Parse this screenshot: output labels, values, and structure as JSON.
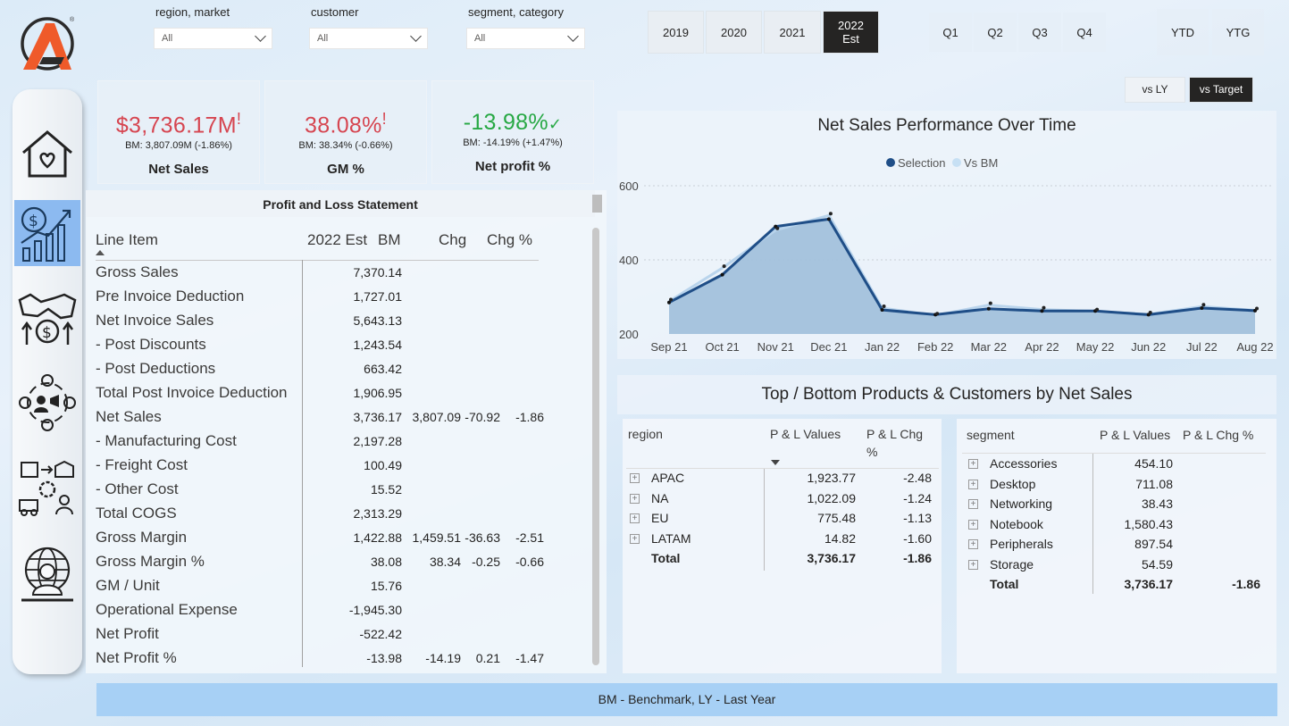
{
  "slicers": [
    {
      "label": "region, market",
      "value": "All"
    },
    {
      "label": "customer",
      "value": "All"
    },
    {
      "label": "segment, category",
      "value": "All"
    }
  ],
  "years": [
    "2019",
    "2020",
    "2021"
  ],
  "year_active_line1": "2022",
  "year_active_line2": "Est",
  "quarters": [
    "Q1",
    "Q2",
    "Q3",
    "Q4"
  ],
  "period": [
    "YTD",
    "YTG"
  ],
  "compare": {
    "vs_ly": "vs LY",
    "vs_target": "vs Target"
  },
  "kpis": [
    {
      "value": "$3,736.17M",
      "flag": "!",
      "sub": "BM: 3,807.09M (-1.86%)",
      "title": "Net Sales",
      "color": "#d64550"
    },
    {
      "value": "38.08%",
      "flag": "!",
      "sub": "BM: 38.34% (-0.66%)",
      "title": "GM %",
      "color": "#d64550"
    },
    {
      "value": "-13.98%",
      "flag": "✓",
      "sub": "BM: -14.19% (+1.47%)",
      "title": "Net profit %",
      "color": "#27a844"
    }
  ],
  "pl": {
    "title": "Profit and Loss Statement",
    "headers": {
      "item": "Line Item",
      "y": "2022 Est",
      "bm": "BM",
      "chg": "Chg",
      "chgp": "Chg %"
    },
    "rows": [
      {
        "item": "Gross Sales",
        "y": "7,370.14",
        "bm": "",
        "chg": "",
        "chgp": ""
      },
      {
        "item": "Pre Invoice Deduction",
        "y": "1,727.01",
        "bm": "",
        "chg": "",
        "chgp": ""
      },
      {
        "item": "Net Invoice Sales",
        "y": "5,643.13",
        "bm": "",
        "chg": "",
        "chgp": ""
      },
      {
        "item": "- Post Discounts",
        "y": "1,243.54",
        "bm": "",
        "chg": "",
        "chgp": ""
      },
      {
        "item": "- Post Deductions",
        "y": "663.42",
        "bm": "",
        "chg": "",
        "chgp": ""
      },
      {
        "item": "Total Post Invoice Deduction",
        "y": "1,906.95",
        "bm": "",
        "chg": "",
        "chgp": ""
      },
      {
        "item": "Net Sales",
        "y": "3,736.17",
        "bm": "3,807.09",
        "chg": "-70.92",
        "chgp": "-1.86"
      },
      {
        "item": "- Manufacturing Cost",
        "y": "2,197.28",
        "bm": "",
        "chg": "",
        "chgp": ""
      },
      {
        "item": "- Freight Cost",
        "y": "100.49",
        "bm": "",
        "chg": "",
        "chgp": ""
      },
      {
        "item": "- Other Cost",
        "y": "15.52",
        "bm": "",
        "chg": "",
        "chgp": ""
      },
      {
        "item": "Total COGS",
        "y": "2,313.29",
        "bm": "",
        "chg": "",
        "chgp": ""
      },
      {
        "item": "Gross Margin",
        "y": "1,422.88",
        "bm": "1,459.51",
        "chg": "-36.63",
        "chgp": "-2.51"
      },
      {
        "item": "Gross Margin %",
        "y": "38.08",
        "bm": "38.34",
        "chg": "-0.25",
        "chgp": "-0.66"
      },
      {
        "item": "GM / Unit",
        "y": "15.76",
        "bm": "",
        "chg": "",
        "chgp": ""
      },
      {
        "item": "Operational Expense",
        "y": "-1,945.30",
        "bm": "",
        "chg": "",
        "chgp": ""
      },
      {
        "item": "Net Profit",
        "y": "-522.42",
        "bm": "",
        "chg": "",
        "chgp": ""
      },
      {
        "item": "Net Profit %",
        "y": "-13.98",
        "bm": "-14.19",
        "chg": "0.21",
        "chgp": "-1.47"
      }
    ]
  },
  "chart_data": {
    "type": "area",
    "title": "Net Sales Performance Over Time",
    "categories": [
      "Sep 21",
      "Oct 21",
      "Nov 21",
      "Dec 21",
      "Jan 22",
      "Feb 22",
      "Mar 22",
      "Apr 22",
      "May 22",
      "Jun 22",
      "Jul 22",
      "Aug 22"
    ],
    "series": [
      {
        "name": "Selection",
        "values": [
          285,
          360,
          490,
          510,
          265,
          252,
          268,
          262,
          262,
          252,
          270,
          263
        ],
        "color": "#1f4e87"
      },
      {
        "name": "Vs BM",
        "values": [
          288,
          378,
          480,
          520,
          270,
          250,
          278,
          266,
          261,
          253,
          274,
          264
        ],
        "color": "#c7e0f4"
      }
    ],
    "yticks": [
      200,
      400,
      600
    ],
    "ylim": [
      200,
      600
    ],
    "legend": "top-center"
  },
  "top_bottom": {
    "title": "Top / Bottom Products & Customers by Net Sales",
    "region_table": {
      "headers": [
        "region",
        "P & L Values",
        "P & L Chg",
        "%"
      ],
      "rows": [
        {
          "name": "APAC",
          "val": "1,923.77",
          "chg": "-2.48"
        },
        {
          "name": "NA",
          "val": "1,022.09",
          "chg": "-1.24"
        },
        {
          "name": "EU",
          "val": "775.48",
          "chg": "-1.13"
        },
        {
          "name": "LATAM",
          "val": "14.82",
          "chg": "-1.60"
        }
      ],
      "total": {
        "name": "Total",
        "val": "3,736.17",
        "chg": "-1.86"
      }
    },
    "segment_table": {
      "headers": [
        "segment",
        "P & L Values",
        "P & L Chg %"
      ],
      "rows": [
        {
          "name": "Accessories",
          "val": "454.10"
        },
        {
          "name": "Desktop",
          "val": "711.08"
        },
        {
          "name": "Networking",
          "val": "38.43"
        },
        {
          "name": "Notebook",
          "val": "1,580.43"
        },
        {
          "name": "Peripherals",
          "val": "897.54"
        },
        {
          "name": "Storage",
          "val": "54.59"
        }
      ],
      "total": {
        "name": "Total",
        "val": "3,736.17",
        "chg": "-1.86"
      }
    }
  },
  "footer": "BM - Benchmark, LY - Last Year",
  "nav_icons": [
    "home-icon",
    "finance-growth-icon",
    "handshake-dollar-icon",
    "marketing-people-icon",
    "supply-chain-icon",
    "global-executive-icon"
  ]
}
